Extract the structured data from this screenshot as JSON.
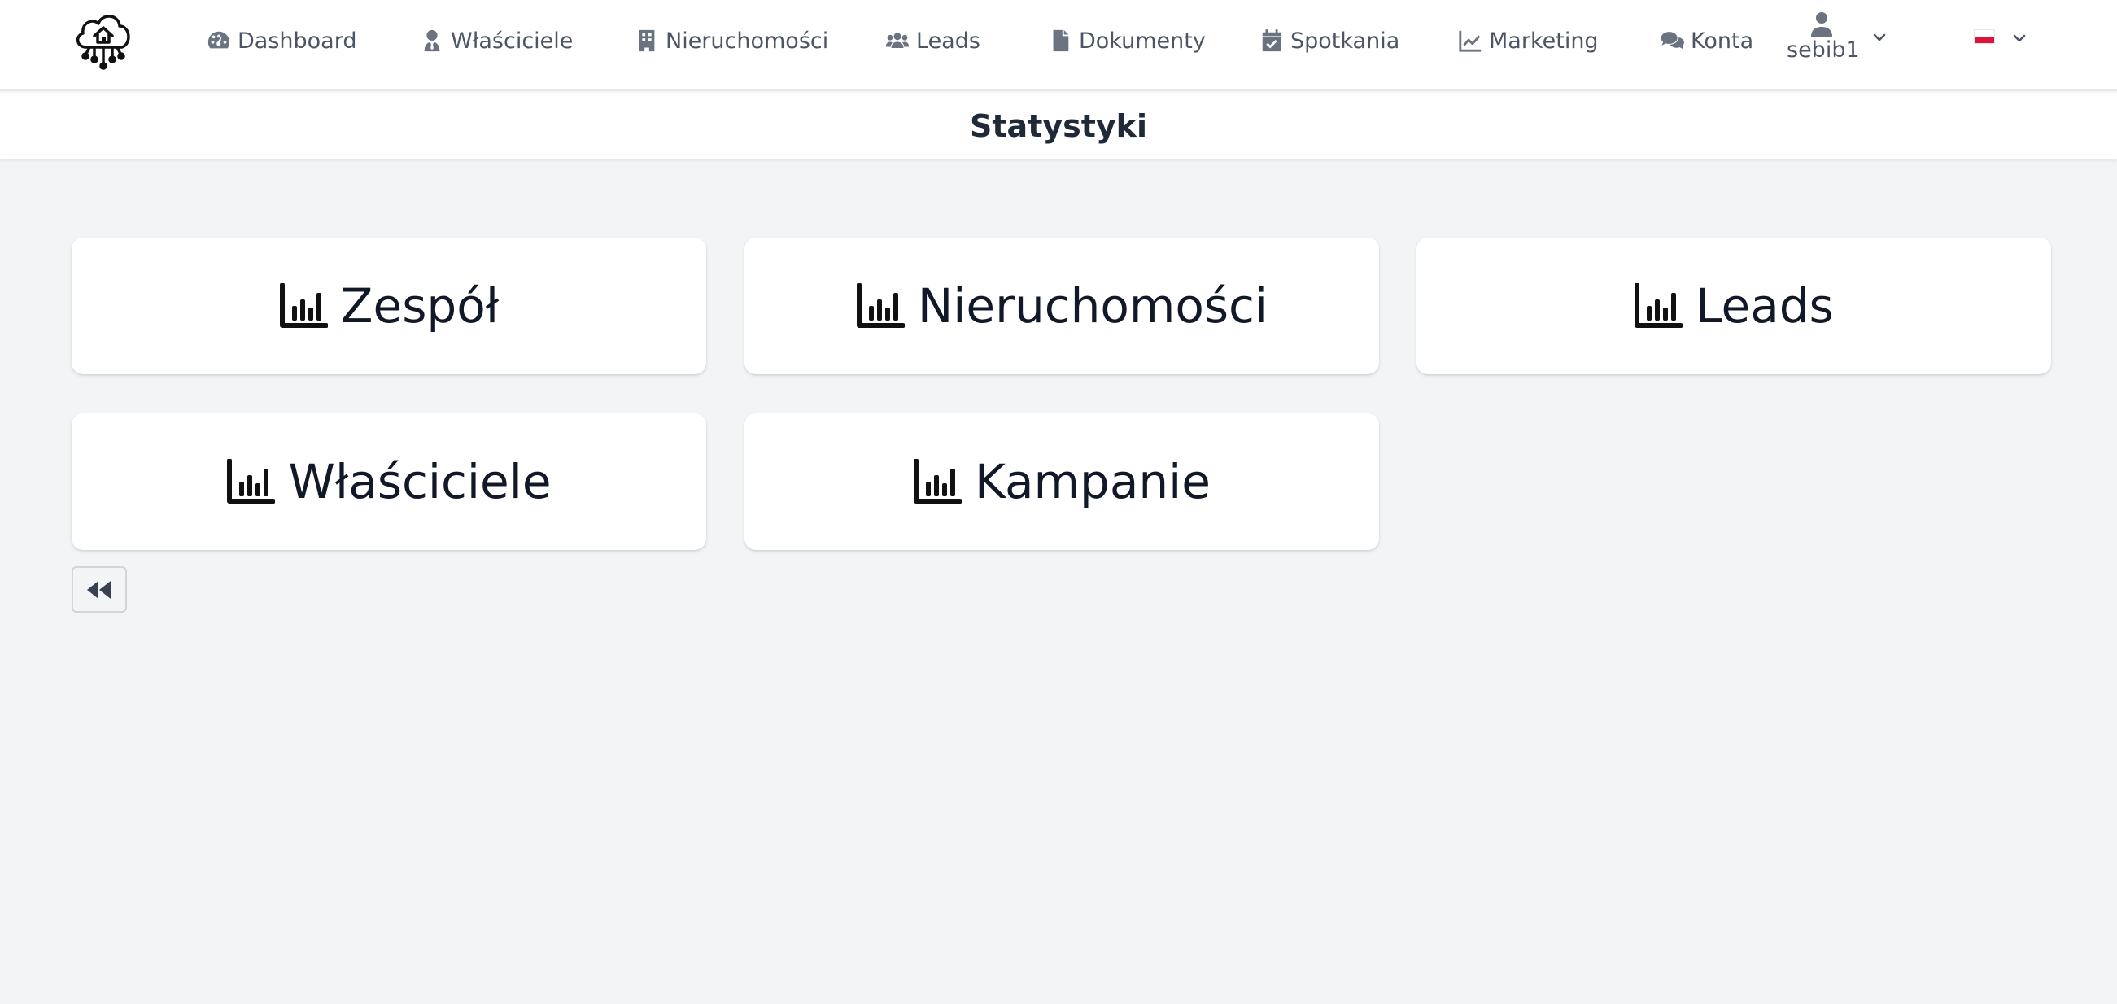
{
  "nav": {
    "logo_icon": "cloud-house-logo-icon",
    "items": [
      {
        "label": "Dashboard",
        "icon": "gauge-icon"
      },
      {
        "label": "Właściciele",
        "icon": "user-tie-icon"
      },
      {
        "label": "Nieruchomości",
        "icon": "building-icon"
      },
      {
        "label": "Leads",
        "icon": "users-icon"
      },
      {
        "label": "Dokumenty",
        "icon": "file-icon"
      },
      {
        "label": "Spotkania",
        "icon": "calendar-check-icon"
      },
      {
        "label": "Marketing",
        "icon": "line-chart-icon"
      },
      {
        "label": "Konta",
        "icon": "comments-icon"
      }
    ],
    "user": {
      "name": "sebib1",
      "icon": "user-icon"
    },
    "language": {
      "selected": "pl",
      "icon": "polish-flag-icon"
    }
  },
  "page": {
    "title": "Statystyki"
  },
  "cards": [
    {
      "label": "Zespół",
      "icon": "bar-chart-icon"
    },
    {
      "label": "Nieruchomości",
      "icon": "bar-chart-icon"
    },
    {
      "label": "Leads",
      "icon": "bar-chart-icon"
    },
    {
      "label": "Właściciele",
      "icon": "bar-chart-icon"
    },
    {
      "label": "Kampanie",
      "icon": "bar-chart-icon"
    }
  ],
  "back_button": {
    "icon": "backward-icon"
  },
  "colors": {
    "background": "#f3f4f6",
    "surface": "#ffffff",
    "nav_text": "#4b5563",
    "card_text": "#111827"
  }
}
